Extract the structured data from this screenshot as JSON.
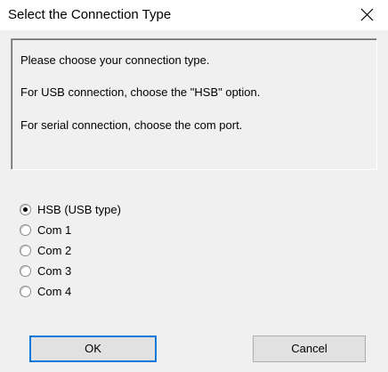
{
  "window": {
    "title": "Select the Connection Type",
    "close_icon": "close-icon"
  },
  "message": {
    "lines": [
      "Please choose your connection type.",
      "For USB connection, choose the \"HSB\" option.",
      "For serial connection, choose the com port."
    ]
  },
  "options": {
    "selected": "HSB (USB type)",
    "items": [
      "HSB (USB type)",
      "Com 1",
      "Com 2",
      "Com 3",
      "Com 4"
    ]
  },
  "buttons": {
    "ok_label": "OK",
    "cancel_label": "Cancel"
  },
  "colors": {
    "dialog_background": "#f0f0f0",
    "titlebar_background": "#ffffff",
    "focus_accent": "#0078d7"
  }
}
